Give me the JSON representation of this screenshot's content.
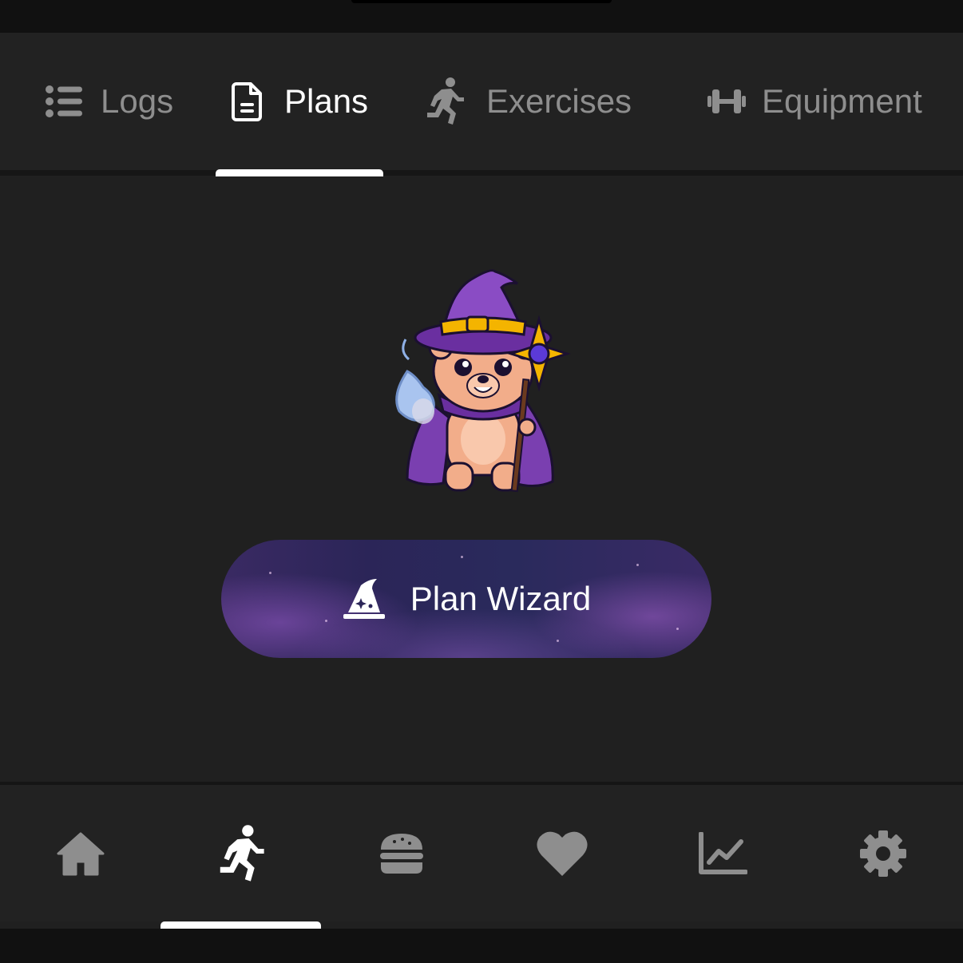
{
  "tabs": [
    {
      "id": "logs",
      "label": "Logs",
      "icon": "list-icon",
      "active": false
    },
    {
      "id": "plans",
      "label": "Plans",
      "icon": "document-icon",
      "active": true
    },
    {
      "id": "exercises",
      "label": "Exercises",
      "icon": "running-icon",
      "active": false
    },
    {
      "id": "equipment",
      "label": "Equipment",
      "icon": "dumbbell-icon",
      "active": false
    }
  ],
  "main": {
    "mascot": "wizard-bear-mascot",
    "wizard_button_label": "Plan Wizard",
    "wizard_button_icon": "wizard-hat-icon"
  },
  "bottom_nav": [
    {
      "id": "home",
      "icon": "home-icon",
      "active": false
    },
    {
      "id": "workout",
      "icon": "running-icon",
      "active": true
    },
    {
      "id": "nutrition",
      "icon": "burger-icon",
      "active": false
    },
    {
      "id": "health",
      "icon": "heart-icon",
      "active": false
    },
    {
      "id": "progress",
      "icon": "chart-line-icon",
      "active": false
    },
    {
      "id": "settings",
      "icon": "gear-icon",
      "active": false
    }
  ],
  "colors": {
    "background": "#202020",
    "active": "#ffffff",
    "inactive": "#8e8e8e",
    "button_gradient": "#2b2558"
  }
}
